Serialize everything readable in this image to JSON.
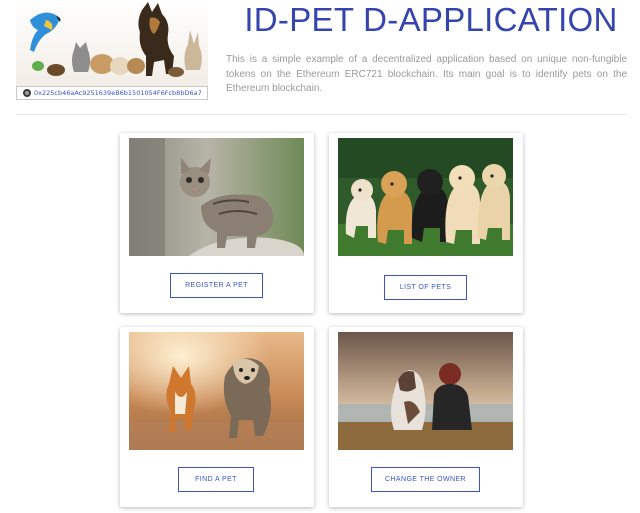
{
  "header": {
    "title": "ID-PET D-APPLICATION",
    "description": "This is a simple example of a decentralized application based on unique non-fungible tokens on the Ethereum ERC721 blockchain. Its main goal is to identify pets on the Ethereum blockchain.",
    "account_address": "0x225cb46aAc9251639eB6b1501054F6Fcb8bD6a7",
    "account_icon": "identicon-icon"
  },
  "cards": [
    {
      "image": "kitten-photo",
      "button_label": "REGISTER A PET"
    },
    {
      "image": "puppies-photo",
      "button_label": "LIST OF PETS"
    },
    {
      "image": "running-dogs-photo",
      "button_label": "FIND A PET"
    },
    {
      "image": "dog-and-owner-photo",
      "button_label": "CHANGE THE OWNER"
    }
  ],
  "colors": {
    "accent": "#3b55c9",
    "title": "#3545b0",
    "description_text": "#9a9a9a"
  }
}
